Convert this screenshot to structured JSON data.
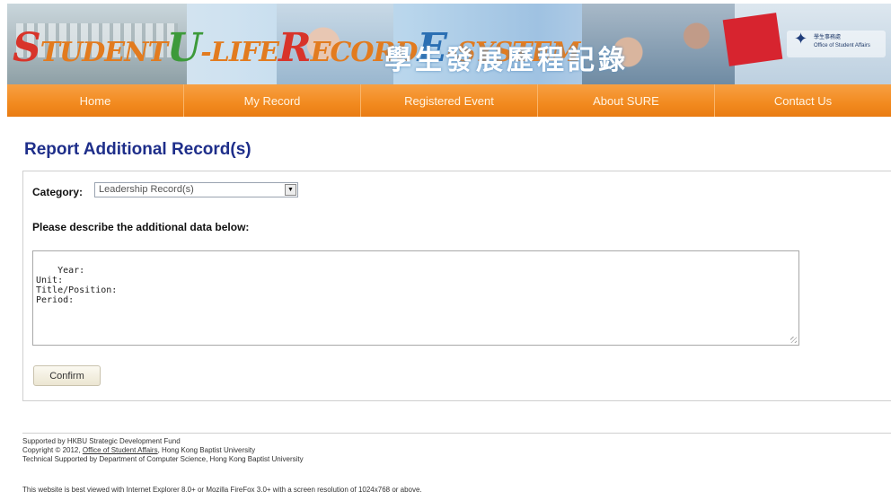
{
  "banner": {
    "title_parts": [
      "S",
      "TUDENT",
      "U",
      "-LIFE",
      "R",
      "ECORD",
      "E",
      "-SYSTEM"
    ],
    "chinese_title": "學生發展歷程記錄",
    "office_badge_zh": "學生事務處",
    "office_badge_en": "Office of Student Affairs"
  },
  "nav": {
    "items": [
      "Home",
      "My Record",
      "Registered Event",
      "About SURE",
      "Contact Us"
    ]
  },
  "page": {
    "title": "Report Additional Record(s)"
  },
  "form": {
    "category_label": "Category:",
    "category_value": "Leadership Record(s)",
    "description_label": "Please describe the additional data below:",
    "description_value": "Year:\nUnit:\nTitle/Position:\nPeriod:",
    "confirm_label": "Confirm"
  },
  "footer": {
    "line1": "Supported by HKBU Strategic Development Fund",
    "line2_prefix": "Copyright © 2012,",
    "line2_link": "Office of Student Affairs",
    "line2_suffix": ", Hong Kong Baptist University",
    "line3": "Technical Supported by Department of Computer Science, Hong Kong Baptist University",
    "note": "This website is best viewed with Internet Explorer 8.0+ or Mozilla FireFox 3.0+ with a screen resolution of 1024x768 or above."
  },
  "colors": {
    "nav_orange": "#f28a1f",
    "title_blue": "#1e2e8a"
  }
}
